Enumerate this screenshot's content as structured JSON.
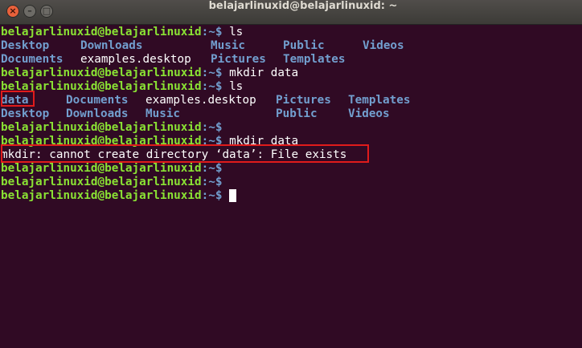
{
  "window": {
    "title": "belajarlinuxid@belajarlinuxid: ~",
    "buttons": {
      "close": "×",
      "minimize": "–",
      "maximize": "□"
    }
  },
  "prompt": {
    "user_host": "belajarlinuxid@belajarlinuxid",
    "path_sep": ":~$ "
  },
  "lines": [
    {
      "command": "ls"
    },
    {
      "entries": [
        "Desktop",
        "Downloads",
        "Music",
        "Public",
        "Videos"
      ]
    },
    {
      "entries": [
        "Documents",
        "examples.desktop",
        "Pictures",
        "Templates"
      ]
    },
    {
      "command": "mkdir data"
    },
    {
      "command": "ls"
    },
    {
      "entries": [
        "data",
        "Documents",
        "examples.desktop",
        "Pictures",
        "Templates"
      ]
    },
    {
      "entries": [
        "Desktop",
        "Downloads",
        "Music",
        "Public",
        "Videos"
      ]
    },
    {
      "command": ""
    },
    {
      "command": "mkdir data"
    },
    {
      "output": "mkdir: cannot create directory ‘data’: File exists"
    },
    {
      "command": ""
    },
    {
      "command": ""
    },
    {
      "command": ""
    }
  ],
  "colors": {
    "background": "#300a24",
    "prompt": "#8ae234",
    "directory": "#729fcf",
    "text": "#ffffff",
    "highlight": "#e01b1b"
  }
}
